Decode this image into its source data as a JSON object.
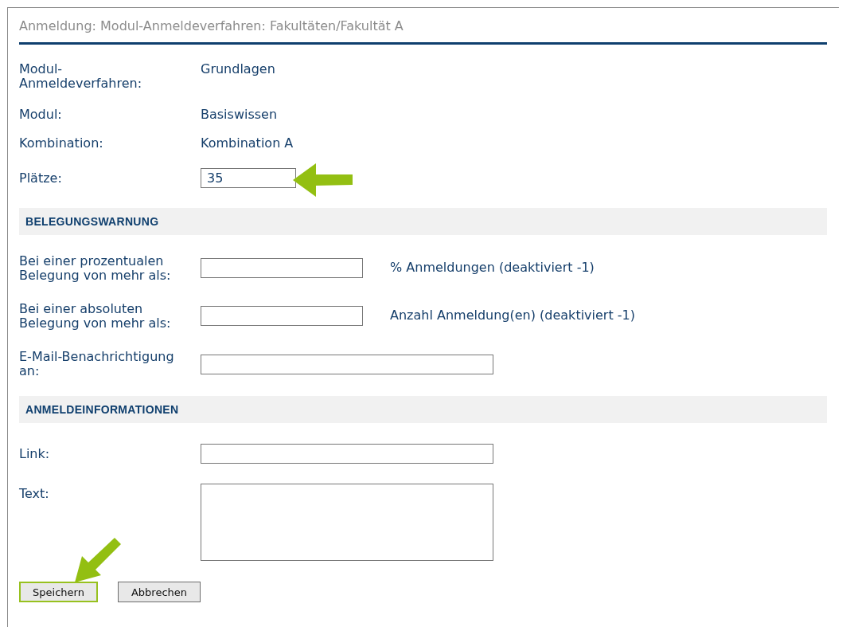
{
  "title": "Anmeldung: Modul-Anmeldeverfahren: Fakultäten/Fakultät A",
  "info_rows": [
    {
      "label": "Modul-Anmeldeverfahren:",
      "value": "Grundlagen"
    },
    {
      "label": "Modul:",
      "value": "Basiswissen"
    },
    {
      "label": "Kombination:",
      "value": "Kombination A"
    }
  ],
  "places": {
    "label": "Plätze:",
    "value": "35",
    "arrow": true
  },
  "sections": [
    {
      "heading": "BELEGUNGSWARNUNG",
      "fields": [
        {
          "kind": "short",
          "label": "Bei einer prozentualen Belegung von mehr als:",
          "hint": "% Anmeldungen (deaktiviert -1)"
        },
        {
          "kind": "short",
          "label": "Bei einer absoluten Belegung von mehr als:",
          "hint": "Anzahl Anmeldung(en) (deaktiviert -1)"
        },
        {
          "kind": "long",
          "label": "E-Mail-Benachrichtigung an:"
        }
      ]
    },
    {
      "heading": "ANMELDEINFORMATIONEN",
      "fields": [
        {
          "kind": "long",
          "label": "Link:"
        },
        {
          "kind": "area",
          "label": "Text:"
        }
      ]
    }
  ],
  "buttons": [
    {
      "label": "Speichern",
      "highlighted": true,
      "arrow": true
    },
    {
      "label": "Abbrechen",
      "highlighted": false,
      "arrow": false
    }
  ]
}
